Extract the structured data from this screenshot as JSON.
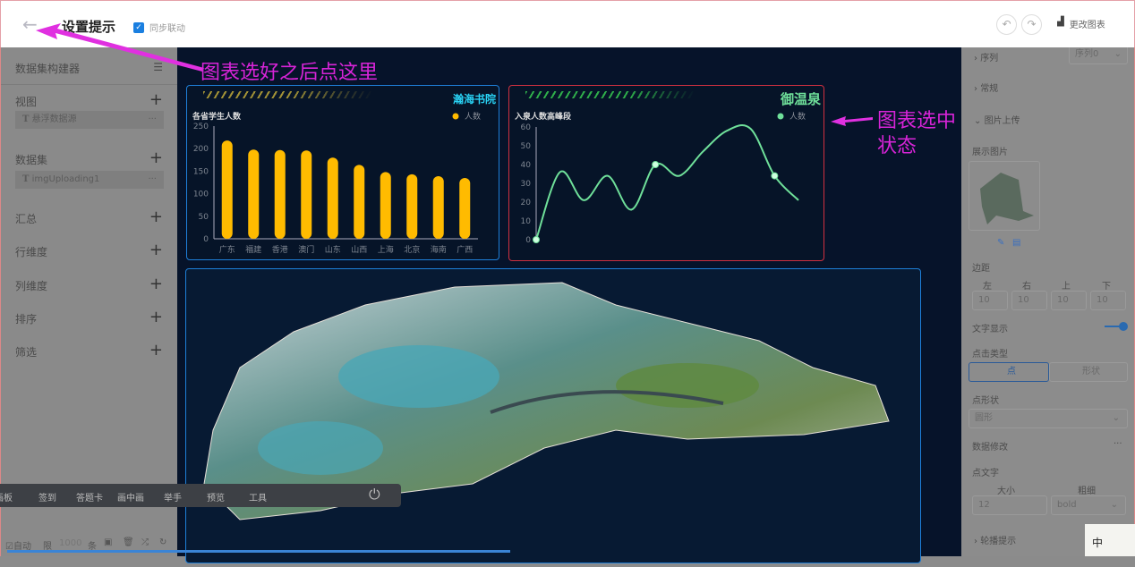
{
  "header": {
    "title": "设置提示",
    "sync_label": "同步联动",
    "sync_checked": true,
    "change_chart": "更改图表"
  },
  "left": {
    "title": "数据集构建器",
    "sections": [
      {
        "label": "视图",
        "item": "悬浮数据源"
      },
      {
        "label": "数据集",
        "item": "imgUploading1"
      },
      {
        "label": "汇总"
      },
      {
        "label": "行维度"
      },
      {
        "label": "列维度"
      },
      {
        "label": "排序"
      },
      {
        "label": "筛选"
      }
    ],
    "more": "···"
  },
  "right": {
    "series_label": "序列",
    "series_value": "序列0",
    "general": "常规",
    "image_upload": "图片上传",
    "show_image": "展示图片",
    "margin": "边距",
    "margin_labels": [
      "左",
      "右",
      "上",
      "下"
    ],
    "margin_values": [
      "10",
      "10",
      "10",
      "10"
    ],
    "text_display": "文字显示",
    "text_display_on": true,
    "click_type": "点击类型",
    "click_options": [
      "点",
      "形状"
    ],
    "point_shape": "点形状",
    "point_shape_value": "圆形",
    "data_edit": "数据修改",
    "point_text": "点文字",
    "size_label": "大小",
    "weight_label": "粗细",
    "size_value": "12",
    "weight_value": "bold",
    "outline_tip": "轮播提示",
    "more": "···"
  },
  "toolbar": {
    "items": [
      "画板",
      "签到",
      "答题卡",
      "画中画",
      "举手",
      "预览",
      "工具"
    ]
  },
  "bottom": {
    "auto": "自动",
    "limit": "限",
    "limit_value": "1000",
    "unit": "条"
  },
  "annotations": {
    "a1": "图表选好之后点这里",
    "a2": "图表选中\n状态"
  },
  "colors": {
    "bar": "#ffbb00",
    "line": "#6fe09a",
    "accent": "#1a7fe0",
    "annot": "#d824d8"
  },
  "chart_data": [
    {
      "type": "bar",
      "panel_title": "瀚海书院",
      "title": "各省学生人数",
      "legend": "人数",
      "categories": [
        "广东",
        "福建",
        "香港",
        "澳门",
        "山东",
        "山西",
        "上海",
        "北京",
        "海南",
        "广西"
      ],
      "values": [
        218,
        198,
        197,
        196,
        180,
        164,
        148,
        143,
        139,
        135
      ],
      "ylim": [
        0,
        250
      ],
      "yticks": [
        0,
        50,
        100,
        150,
        200,
        250
      ]
    },
    {
      "type": "line",
      "panel_title": "御温泉",
      "title": "入泉人数高峰段",
      "legend": "人数",
      "values": [
        0,
        36,
        21,
        34,
        16,
        40,
        34,
        47,
        58,
        59,
        34,
        21
      ],
      "ylim": [
        0,
        60
      ],
      "yticks": [
        0,
        10,
        20,
        30,
        40,
        50,
        60
      ]
    }
  ]
}
